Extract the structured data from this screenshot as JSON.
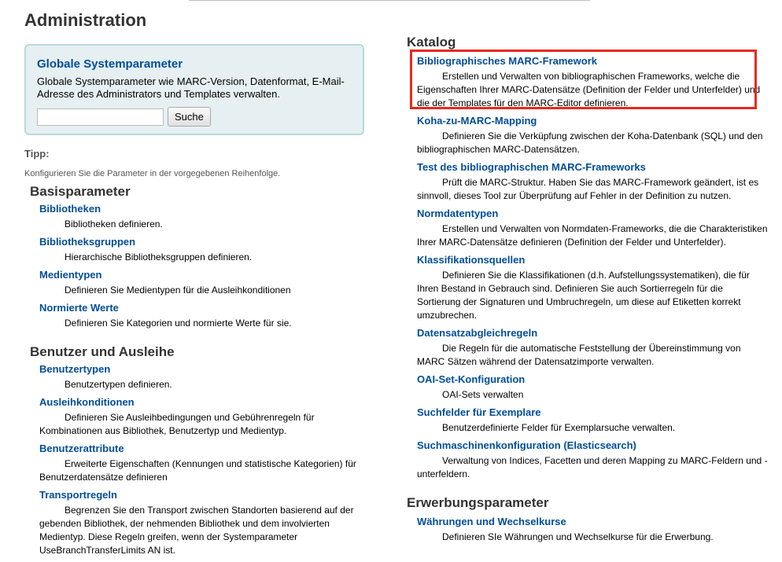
{
  "page": {
    "title": "Administration"
  },
  "system_prefs": {
    "title": "Globale Systemparameter",
    "description": "Globale Systemparameter wie MARC-Version, Datenformat, E-Mail-Adresse des Administrators und Templates verwalten.",
    "search_value": "",
    "search_button": "Suche"
  },
  "tip": {
    "heading": "Tipp:",
    "text": "Konfigurieren Sie die Parameter in der vorgegebenen Reihenfolge."
  },
  "basic": {
    "heading": "Basisparameter",
    "items": [
      {
        "label": "Bibliotheken",
        "desc": "Bibliotheken definieren."
      },
      {
        "label": "Bibliotheksgruppen",
        "desc": "Hierarchische Bibliotheksgruppen definieren."
      },
      {
        "label": "Medientypen",
        "desc": "Definieren Sie Medientypen für die Ausleihkonditionen"
      },
      {
        "label": "Normierte Werte",
        "desc": "Definieren Sie Kategorien und normierte Werte für sie."
      }
    ]
  },
  "patrons": {
    "heading": "Benutzer und Ausleihe",
    "items": [
      {
        "label": "Benutzertypen",
        "desc": "Benutzertypen definieren."
      },
      {
        "label": "Ausleihkonditionen",
        "desc": "Definieren Sie Ausleihbedingungen und Gebührenregeln für Kombinationen aus Bibliothek, Benutzertyp und Medientyp."
      },
      {
        "label": "Benutzerattribute",
        "desc": "Erweiterte Eigenschaften (Kennungen und statistische Kategorien) für Benutzerdatensätze definieren"
      },
      {
        "label": "Transportregeln",
        "desc": "Begrenzen Sie den Transport zwischen Standorten basierend auf der gebenden Bibliothek, der nehmenden Bibliothek und dem involvierten Medientyp. Diese Regeln greifen, wenn der Systemparameter UseBranchTransferLimits AN ist."
      }
    ]
  },
  "catalog": {
    "heading": "Katalog",
    "items": [
      {
        "label": "Bibliographisches MARC-Framework",
        "desc": "Erstellen und Verwalten von bibliographischen Frameworks, welche die Eigenschaften Ihrer MARC-Datensätze (Definition der Felder und Unterfelder) und die der Templates für den MARC-Editor definieren."
      },
      {
        "label": "Koha-zu-MARC-Mapping",
        "desc": "Definieren Sie die Verküpfung zwischen der Koha-Datenbank (SQL) und den bibliographischen MARC-Datensätzen."
      },
      {
        "label": "Test des bibliographischen MARC-Frameworks",
        "desc": "Prüft die MARC-Struktur. Haben Sie das MARC-Framework geändert, ist es sinnvoll, dieses Tool zur Überprüfung auf Fehler in der Definition zu nutzen."
      },
      {
        "label": "Normdatentypen",
        "desc": "Erstellen und Verwalten von Normdaten-Frameworks, die die Charakteristiken Ihrer MARC-Datensätze definieren (Definition der Felder und Unterfelder)."
      },
      {
        "label": "Klassifikationsquellen",
        "desc": "Definieren Sie die Klassifikationen (d.h. Aufstellungssystematiken), die für Ihren Bestand in Gebrauch sind. Definieren Sie auch Sortierregeln für die Sortierung der Signaturen und Umbruchregeln, um diese auf Etiketten korrekt umzubrechen."
      },
      {
        "label": "Datensatzabgleichregeln",
        "desc": "Die Regeln für die automatische Feststellung der Übereinstimmung von MARC Sätzen während der Datensatzimporte verwalten."
      },
      {
        "label": "OAI-Set-Konfiguration",
        "desc": "OAI-Sets verwalten"
      },
      {
        "label": "Suchfelder für Exemplare",
        "desc": "Benutzerdefinierte Felder für Exemplarsuche verwalten."
      },
      {
        "label": "Suchmaschinenkonfiguration (Elasticsearch)",
        "desc": "Verwaltung von Indices, Facetten und deren Mapping zu MARC-Feldern und -unterfeldern."
      }
    ]
  },
  "acquisitions": {
    "heading": "Erwerbungsparameter",
    "items": [
      {
        "label": "Währungen und Wechselkurse",
        "desc": "Definieren SIe Währungen und Wechselkurse für die Erwerbung."
      }
    ]
  },
  "colors": {
    "link": "#004d99",
    "highlight": "#e8291e",
    "box_bg": "#e6f0f2"
  }
}
